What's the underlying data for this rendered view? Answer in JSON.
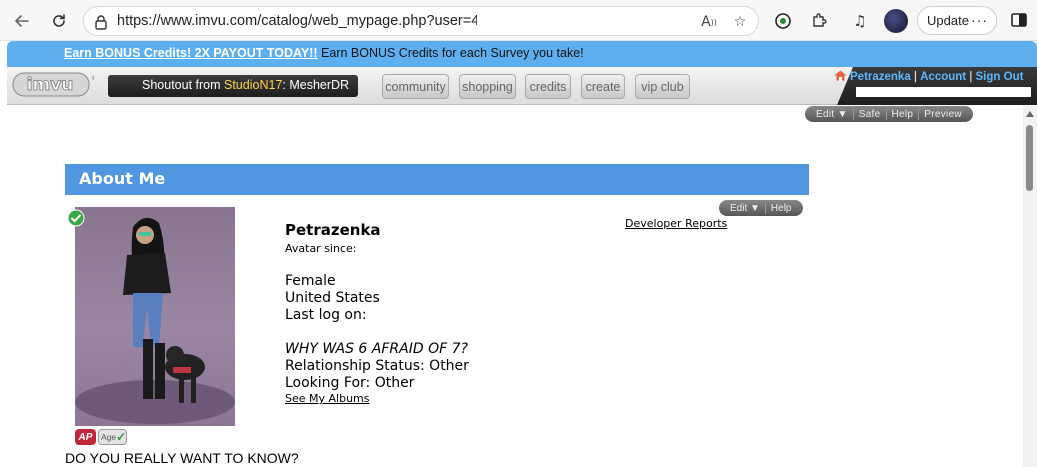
{
  "browser": {
    "url": "https://www.imvu.com/catalog/web_mypage.php?user=4",
    "update_label": "Update",
    "more_label": "···"
  },
  "bonus": {
    "link_text": "Earn BONUS Credits! 2X PAYOUT TODAY!!",
    "tail_text": " Earn BONUS Credits for each Survey you take!"
  },
  "header": {
    "logo_text": "imvu",
    "shoutout_prefix": "Shoutout from ",
    "shoutout_user": "StudioN17",
    "shoutout_colon": ": ",
    "shoutout_msg": "MesherDR",
    "nav": [
      "community",
      "shopping",
      "credits",
      "create",
      "vip club"
    ],
    "username": "Petrazenka",
    "account_label": "Account",
    "signout_label": "Sign Out",
    "separator": " | "
  },
  "edit_bar": [
    "Edit ▼",
    "Safe",
    "Help",
    "Preview"
  ],
  "panel": {
    "title": "About Me",
    "mini_bar": [
      "Edit ▼",
      "Help"
    ],
    "developer_reports": "Developer Reports"
  },
  "profile": {
    "name": "Petrazenka",
    "avatar_since": "Avatar since:",
    "gender": "Female",
    "country": "United States",
    "last_log_on": "Last log on:",
    "tagline": "WHY WAS 6 AFRAID OF 7?",
    "relationship": "Relationship Status: Other",
    "looking_for": "Looking For: Other",
    "albums_link": "See My Albums",
    "badge_ap": "AP",
    "badge_age": "Age"
  },
  "bottom_text": "DO YOU REALLY WANT TO KNOW?"
}
